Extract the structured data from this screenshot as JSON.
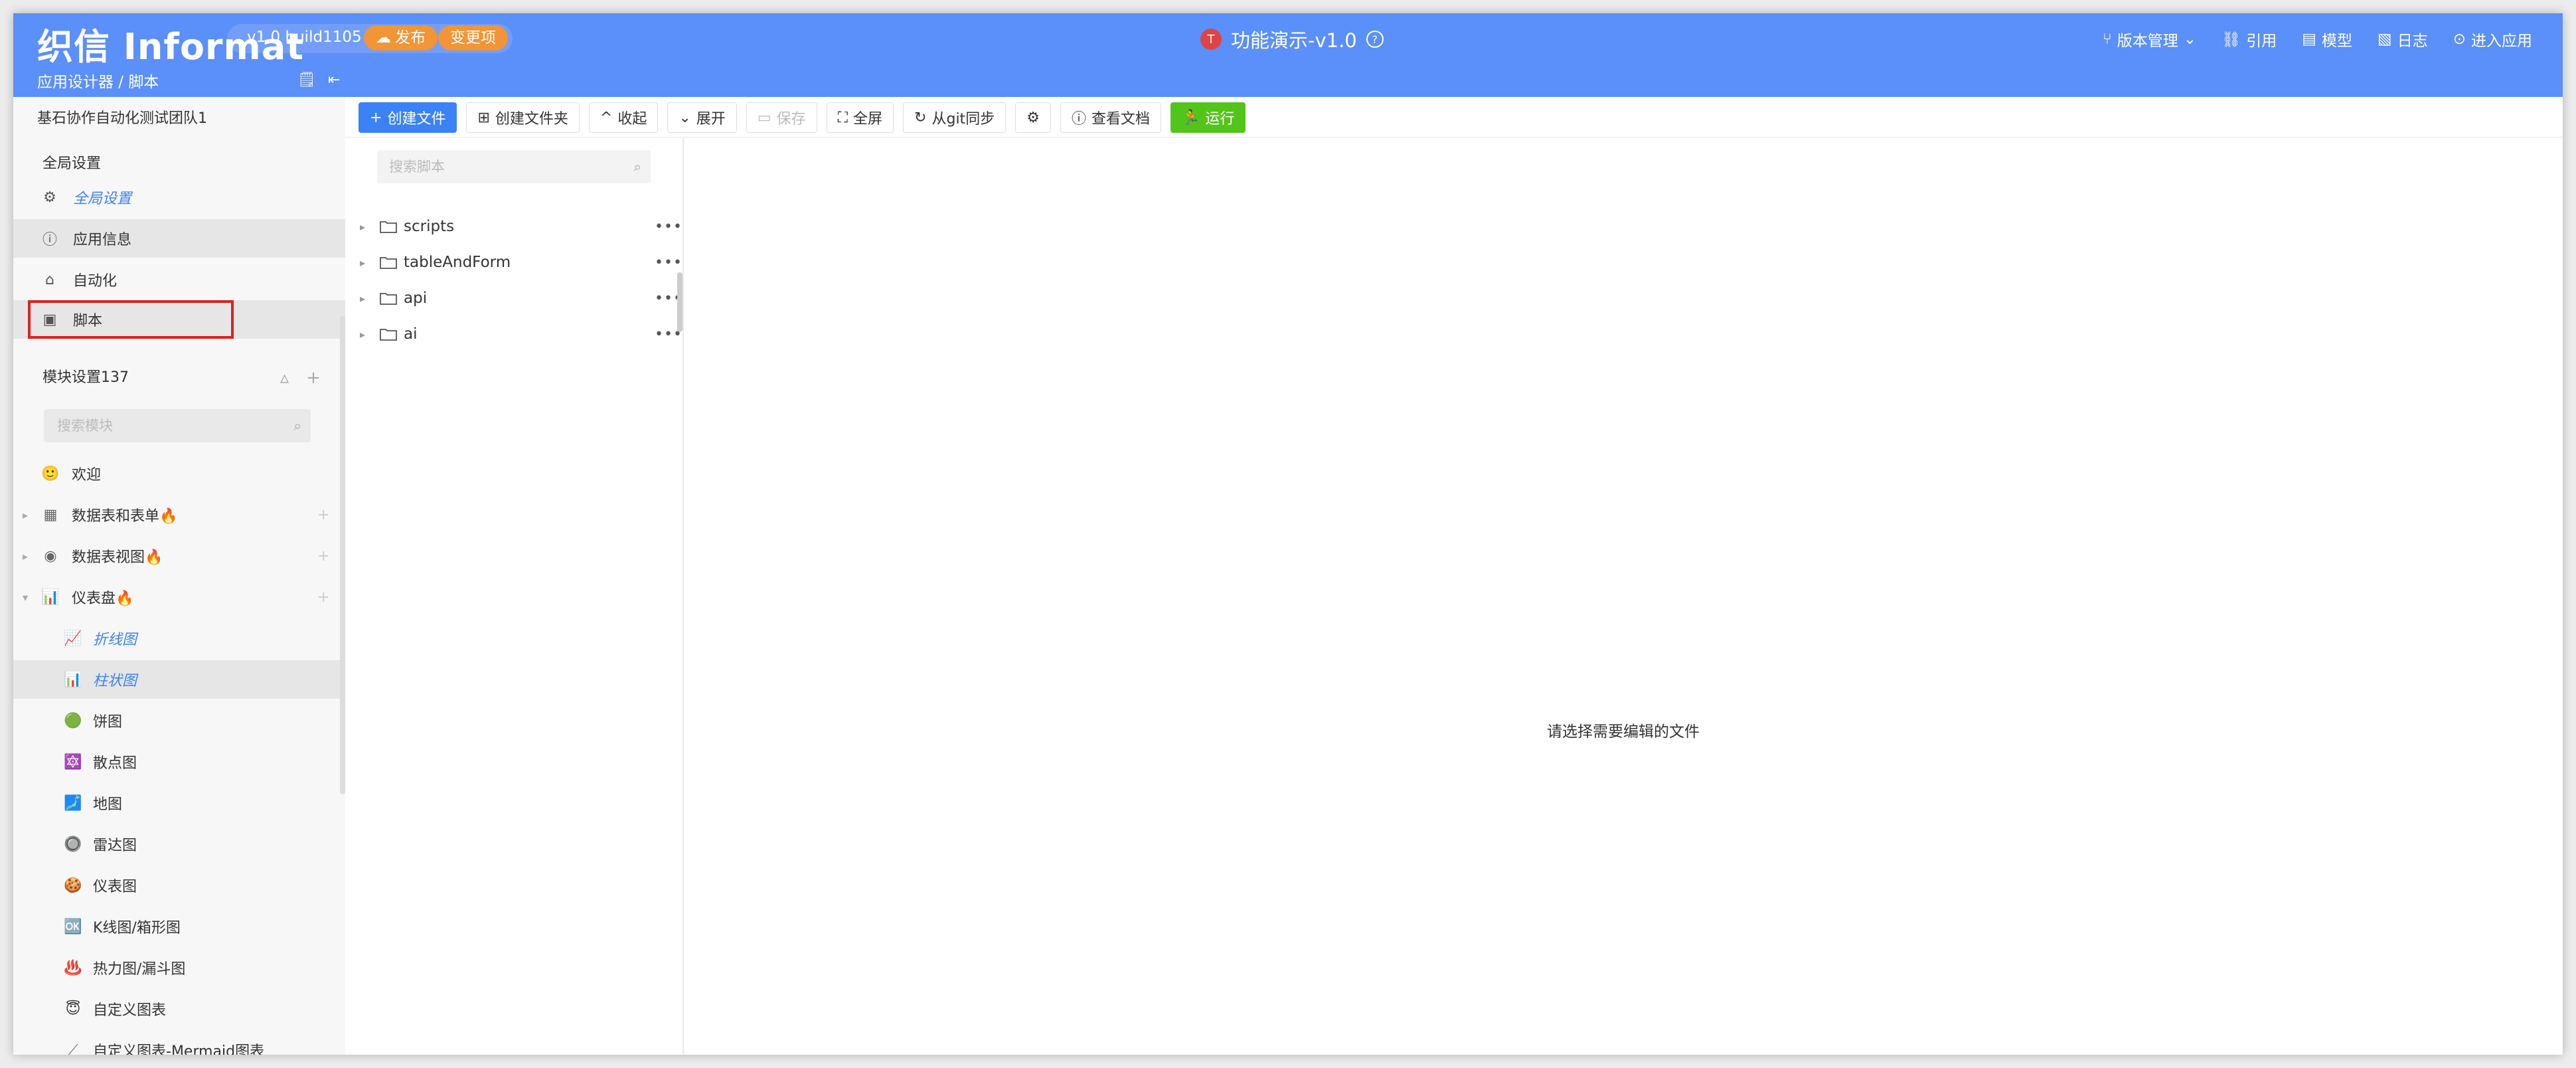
{
  "header": {
    "logo": "织信 Informat",
    "version": "v1.0 build1105",
    "publish_label": "发布",
    "changes_label": "变更项",
    "app_title": "功能演示-v1.0",
    "nav": [
      {
        "label": "版本管理",
        "icon": "branch-icon"
      },
      {
        "label": "引用",
        "icon": "reference-icon"
      },
      {
        "label": "模型",
        "icon": "model-icon"
      },
      {
        "label": "日志",
        "icon": "log-icon"
      },
      {
        "label": "进入应用",
        "icon": "enter-app-icon"
      }
    ],
    "breadcrumb": "应用设计器 / 脚本"
  },
  "sidebar": {
    "team": "基石协作自动化测试团队1",
    "global_section": "全局设置",
    "items": [
      {
        "label": "全局设置",
        "icon": "gear-icon"
      },
      {
        "label": "应用信息",
        "icon": "info-icon"
      },
      {
        "label": "自动化",
        "icon": "robot-icon"
      },
      {
        "label": "脚本",
        "icon": "script-icon"
      }
    ],
    "module_section": "模块设置137",
    "module_search_placeholder": "搜索模块",
    "modules": [
      {
        "label": "欢迎",
        "icon": "🙂"
      },
      {
        "label": "数据表和表单🔥",
        "icon": "▦"
      },
      {
        "label": "数据表视图🔥",
        "icon": "◉"
      },
      {
        "label": "仪表盘🔥",
        "icon": "📊"
      },
      {
        "label": "折线图",
        "icon": "📈"
      },
      {
        "label": "柱状图",
        "icon": "📊"
      },
      {
        "label": "饼图",
        "icon": "🟢"
      },
      {
        "label": "散点图",
        "icon": "🔯"
      },
      {
        "label": "地图",
        "icon": "🗾"
      },
      {
        "label": "雷达图",
        "icon": "🔘"
      },
      {
        "label": "仪表图",
        "icon": "🍪"
      },
      {
        "label": "K线图/箱形图",
        "icon": "🆗"
      },
      {
        "label": "热力图/漏斗图",
        "icon": "♨️"
      },
      {
        "label": "自定义图表",
        "icon": "😇"
      },
      {
        "label": "自定义图表-Mermaid图表",
        "icon": "⟋"
      }
    ]
  },
  "toolbar": {
    "create_file": "创建文件",
    "create_folder": "创建文件夹",
    "collapse": "收起",
    "expand": "展开",
    "save": "保存",
    "fullscreen": "全屏",
    "git_sync": "从git同步",
    "view_docs": "查看文档",
    "run": "运行"
  },
  "files": {
    "search_placeholder": "搜索脚本",
    "items": [
      "scripts",
      "tableAndForm",
      "api",
      "ai"
    ]
  },
  "editor": {
    "empty_message": "请选择需要编辑的文件"
  },
  "colors": {
    "header_bg": "#5b8ff9",
    "accent": "#3b82f6",
    "run_green": "#52c41a",
    "highlight_red": "#e02020"
  }
}
